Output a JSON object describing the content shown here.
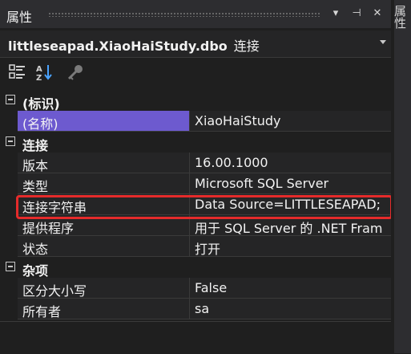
{
  "panel": {
    "title": "属性",
    "buttons": {
      "dropdown": "▾",
      "pin": "⊣",
      "close": "✕"
    }
  },
  "object_selector": {
    "name": "littleseapad.XiaoHaiStudy.dbo",
    "type": "连接"
  },
  "toolbar": {
    "icons": [
      "categorized-icon",
      "alphabetical-sort-icon",
      "property-pages-icon"
    ]
  },
  "grid": {
    "categories": [
      {
        "label": "(标识)",
        "properties": [
          {
            "name": "(名称)",
            "value": "XiaoHaiStudy",
            "selected": true
          }
        ]
      },
      {
        "label": "连接",
        "properties": [
          {
            "name": "版本",
            "value": "16.00.1000"
          },
          {
            "name": "类型",
            "value": "Microsoft SQL Server"
          },
          {
            "name": "连接字符串",
            "value": "Data Source=LITTLESEAPAD;",
            "highlighted": true
          },
          {
            "name": "提供程序",
            "value": "用于 SQL Server 的 .NET Fram"
          },
          {
            "name": "状态",
            "value": "打开"
          }
        ]
      },
      {
        "label": "杂项",
        "properties": [
          {
            "name": "区分大小写",
            "value": "False"
          },
          {
            "name": "所有者",
            "value": "sa"
          }
        ]
      }
    ]
  },
  "side_tab": {
    "label": "属性"
  },
  "colors": {
    "background": "#1f1f1f",
    "selection": "#6d5acf",
    "highlight_border": "#e52b2b"
  }
}
